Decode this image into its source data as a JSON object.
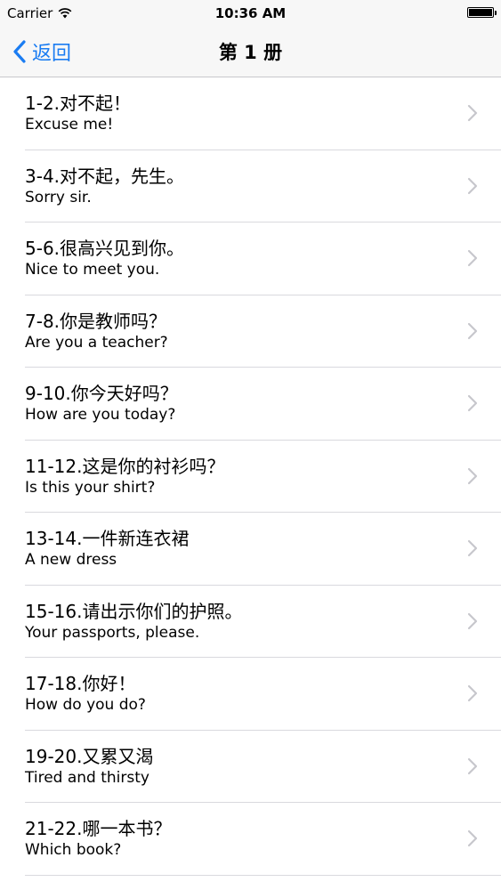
{
  "status_bar": {
    "carrier": "Carrier",
    "time": "10:36 AM"
  },
  "nav": {
    "back_label": "返回",
    "title": "第 1 册"
  },
  "lessons": [
    {
      "title": "1-2.对不起！",
      "subtitle": "Excuse me!"
    },
    {
      "title": "3-4.对不起，先生。",
      "subtitle": "Sorry sir."
    },
    {
      "title": "5-6.很高兴见到你。",
      "subtitle": "Nice to meet you."
    },
    {
      "title": "7-8.你是教师吗？",
      "subtitle": "Are you a teacher?"
    },
    {
      "title": "9-10.你今天好吗？",
      "subtitle": "How are you today?"
    },
    {
      "title": "11-12.这是你的衬衫吗？",
      "subtitle": "Is this your shirt?"
    },
    {
      "title": "13-14.一件新连衣裙",
      "subtitle": "A new dress"
    },
    {
      "title": "15-16.请出示你们的护照。",
      "subtitle": "Your passports, please."
    },
    {
      "title": "17-18.你好！",
      "subtitle": "How do you do?"
    },
    {
      "title": "19-20.又累又渴",
      "subtitle": "Tired and thirsty"
    },
    {
      "title": "21-22.哪一本书？",
      "subtitle": "Which book?"
    }
  ],
  "colors": {
    "accent": "#1a7cf2",
    "separator": "#d9d9de",
    "chevron": "#c7c7cc",
    "bar_background": "#f7f7f7"
  },
  "icons": {
    "wifi": "wifi-icon",
    "battery": "battery-icon",
    "back": "chevron-left-icon",
    "disclosure": "chevron-right-icon"
  }
}
